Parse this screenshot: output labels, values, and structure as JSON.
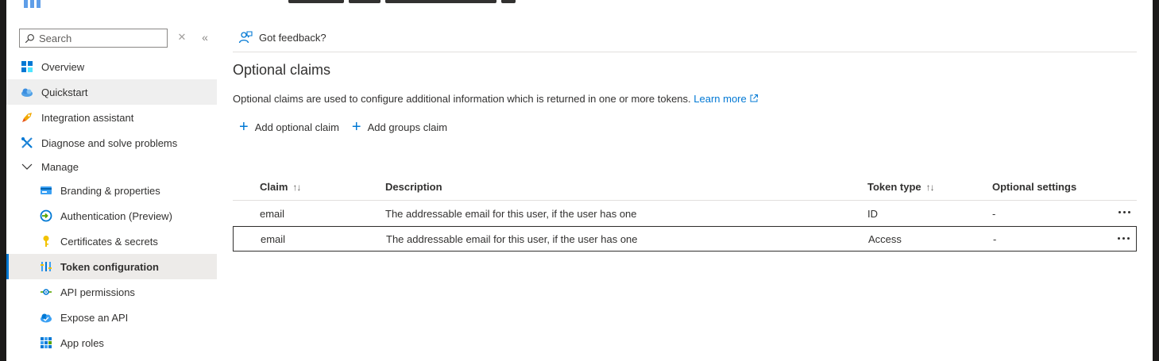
{
  "sidebar": {
    "search": {
      "placeholder": "Search"
    },
    "items": [
      {
        "label": "Overview",
        "icon": "overview-grid-icon"
      },
      {
        "label": "Quickstart",
        "icon": "quickstart-cloud-icon"
      },
      {
        "label": "Integration assistant",
        "icon": "rocket-icon"
      },
      {
        "label": "Diagnose and solve problems",
        "icon": "wrench-icon"
      },
      {
        "label": "Manage",
        "icon": "chevron-down-icon"
      },
      {
        "label": "Branding & properties",
        "icon": "branding-card-icon"
      },
      {
        "label": "Authentication (Preview)",
        "icon": "authentication-icon"
      },
      {
        "label": "Certificates & secrets",
        "icon": "key-icon"
      },
      {
        "label": "Token configuration",
        "icon": "token-bars-icon"
      },
      {
        "label": "API permissions",
        "icon": "api-permissions-icon"
      },
      {
        "label": "Expose an API",
        "icon": "expose-api-cloud-icon"
      },
      {
        "label": "App roles",
        "icon": "app-roles-grid-icon"
      }
    ]
  },
  "main": {
    "feedback_label": "Got feedback?",
    "title": "Optional claims",
    "description": "Optional claims are used to configure additional information which is returned in one or more tokens.",
    "learn_more": "Learn more",
    "actions": {
      "add_optional_claim": "Add optional claim",
      "add_groups_claim": "Add groups claim"
    },
    "table": {
      "headers": {
        "claim": "Claim",
        "description": "Description",
        "token_type": "Token type",
        "optional_settings": "Optional settings"
      },
      "rows": [
        {
          "claim": "email",
          "description": "The addressable email for this user, if the user has one",
          "token_type": "ID",
          "optional_settings": "-"
        },
        {
          "claim": "email",
          "description": "The addressable email for this user, if the user has one",
          "token_type": "Access",
          "optional_settings": "-"
        }
      ]
    }
  },
  "colors": {
    "accent": "#0078d4",
    "selected_bg": "#edebe9"
  }
}
